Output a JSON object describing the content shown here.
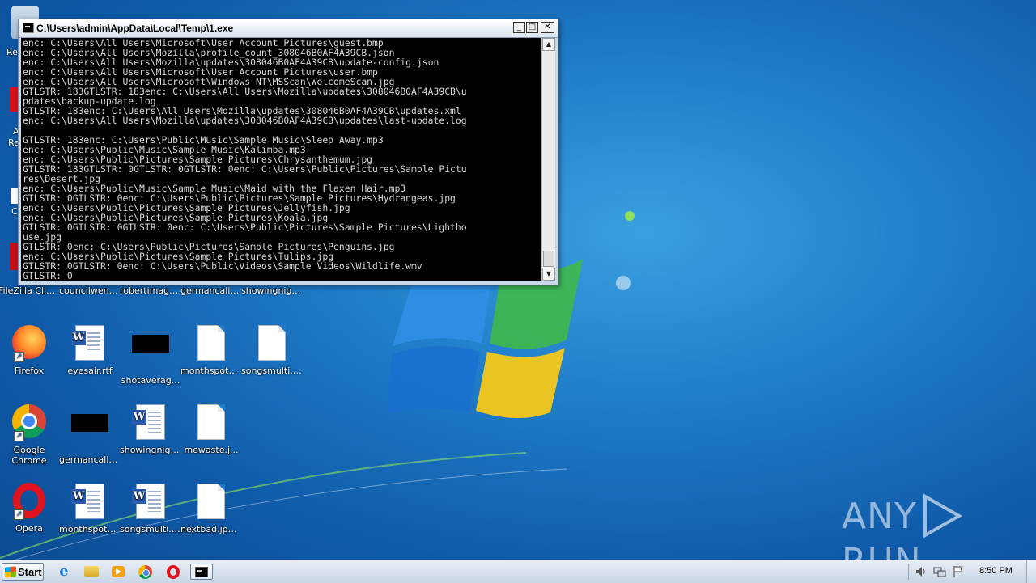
{
  "console_window": {
    "title": "C:\\Users\\admin\\AppData\\Local\\Temp\\1.exe",
    "minimize_glyph": "_",
    "maximize_glyph": "□",
    "close_glyph": "✕",
    "lines": [
      "enc: C:\\Users\\All Users\\Microsoft\\User Account Pictures\\guest.bmp",
      "enc: C:\\Users\\All Users\\Mozilla\\profile_count_308046B0AF4A39CB.json",
      "enc: C:\\Users\\All Users\\Mozilla\\updates\\308046B0AF4A39CB\\update-config.json",
      "enc: C:\\Users\\All Users\\Microsoft\\User Account Pictures\\user.bmp",
      "enc: C:\\Users\\All Users\\Microsoft\\Windows NT\\MSScan\\WelcomeScan.jpg",
      "GTLSTR: 183GTLSTR: 183enc: C:\\Users\\All Users\\Mozilla\\updates\\308046B0AF4A39CB\\u",
      "pdates\\backup-update.log",
      "GTLSTR: 183enc: C:\\Users\\All Users\\Mozilla\\updates\\308046B0AF4A39CB\\updates.xml",
      "enc: C:\\Users\\All Users\\Mozilla\\updates\\308046B0AF4A39CB\\updates\\last-update.log",
      "",
      "GTLSTR: 183enc: C:\\Users\\Public\\Music\\Sample Music\\Sleep Away.mp3",
      "enc: C:\\Users\\Public\\Music\\Sample Music\\Kalimba.mp3",
      "enc: C:\\Users\\Public\\Pictures\\Sample Pictures\\Chrysanthemum.jpg",
      "GTLSTR: 183GTLSTR: 0GTLSTR: 0GTLSTR: 0enc: C:\\Users\\Public\\Pictures\\Sample Pictu",
      "res\\Desert.jpg",
      "enc: C:\\Users\\Public\\Music\\Sample Music\\Maid with the Flaxen Hair.mp3",
      "GTLSTR: 0GTLSTR: 0enc: C:\\Users\\Public\\Pictures\\Sample Pictures\\Hydrangeas.jpg",
      "enc: C:\\Users\\Public\\Pictures\\Sample Pictures\\Jellyfish.jpg",
      "enc: C:\\Users\\Public\\Pictures\\Sample Pictures\\Koala.jpg",
      "GTLSTR: 0GTLSTR: 0GTLSTR: 0enc: C:\\Users\\Public\\Pictures\\Sample Pictures\\Lightho",
      "use.jpg",
      "GTLSTR: 0enc: C:\\Users\\Public\\Pictures\\Sample Pictures\\Penguins.jpg",
      "enc: C:\\Users\\Public\\Pictures\\Sample Pictures\\Tulips.jpg",
      "GTLSTR: 0GTLSTR: 0enc: C:\\Users\\Public\\Videos\\Sample Videos\\Wildlife.wmv",
      "GTLSTR: 0"
    ]
  },
  "desktop_icons": {
    "row1": [
      {
        "label": "FileZilla Client"
      },
      {
        "label": "councilwent..."
      },
      {
        "label": "robertimage..."
      },
      {
        "label": "germancalle..."
      },
      {
        "label": "showingnigh..."
      }
    ],
    "row2": [
      {
        "label": "Firefox",
        "icon": "firefox-icon"
      },
      {
        "label": "eyesair.rtf",
        "icon": "word-document-icon"
      },
      {
        "label": "shotaverag...",
        "icon": "black-thumbnail-icon"
      },
      {
        "label": "monthspote...",
        "icon": "blank-document-icon"
      },
      {
        "label": "songsmulti.r...",
        "icon": "blank-document-icon"
      }
    ],
    "row3": [
      {
        "label": "Google Chrome",
        "icon": "chrome-icon"
      },
      {
        "label": "germancalle...",
        "icon": "black-thumbnail-icon"
      },
      {
        "label": "showingnigh...",
        "icon": "word-document-icon"
      },
      {
        "label": "mewaste.j...",
        "icon": "blank-document-icon"
      }
    ],
    "row4": [
      {
        "label": "Opera",
        "icon": "opera-icon"
      },
      {
        "label": "monthspote...",
        "icon": "word-document-icon"
      },
      {
        "label": "songsmulti.rtf",
        "icon": "word-document-icon"
      },
      {
        "label": "nextbad.jpg.A",
        "icon": "blank-document-icon"
      }
    ],
    "partial_left": [
      "Re",
      "A",
      "Re",
      "C"
    ]
  },
  "watermark": {
    "left": "ANY",
    "right": "RUN"
  },
  "taskbar": {
    "start_label": "Start",
    "clock": "8:50 PM"
  }
}
